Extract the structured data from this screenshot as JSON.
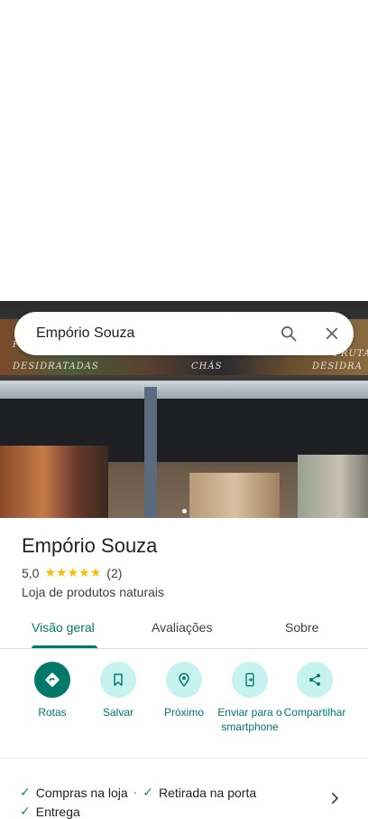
{
  "search": {
    "query": "Empório Souza"
  },
  "hero": {
    "banner_texts": [
      "DESIDRATADAS",
      "CHÁS",
      "DESIDRA",
      "FRUTA",
      "FRUTAS"
    ]
  },
  "place": {
    "name": "Empório Souza",
    "rating": "5,0",
    "stars": 5,
    "review_count": "(2)",
    "category": "Loja de produtos naturais"
  },
  "tabs": [
    {
      "label": "Visão geral",
      "active": true
    },
    {
      "label": "Avaliações",
      "active": false
    },
    {
      "label": "Sobre",
      "active": false
    }
  ],
  "actions": [
    {
      "label": "Rotas",
      "icon": "directions-icon"
    },
    {
      "label": "Salvar",
      "icon": "bookmark-icon"
    },
    {
      "label": "Próximo",
      "icon": "nearby-icon"
    },
    {
      "label": "Enviar para o smartphone",
      "icon": "send-to-phone-icon"
    },
    {
      "label": "Compartilhar",
      "icon": "share-icon"
    }
  ],
  "amenities": {
    "items": [
      "Compras na loja",
      "Retirada na porta",
      "Entrega"
    ],
    "separator": "·"
  },
  "colors": {
    "accent": "#00796b",
    "accent_light": "#c6f3ef",
    "star": "#fbbc04",
    "check": "#1e8e3e"
  }
}
